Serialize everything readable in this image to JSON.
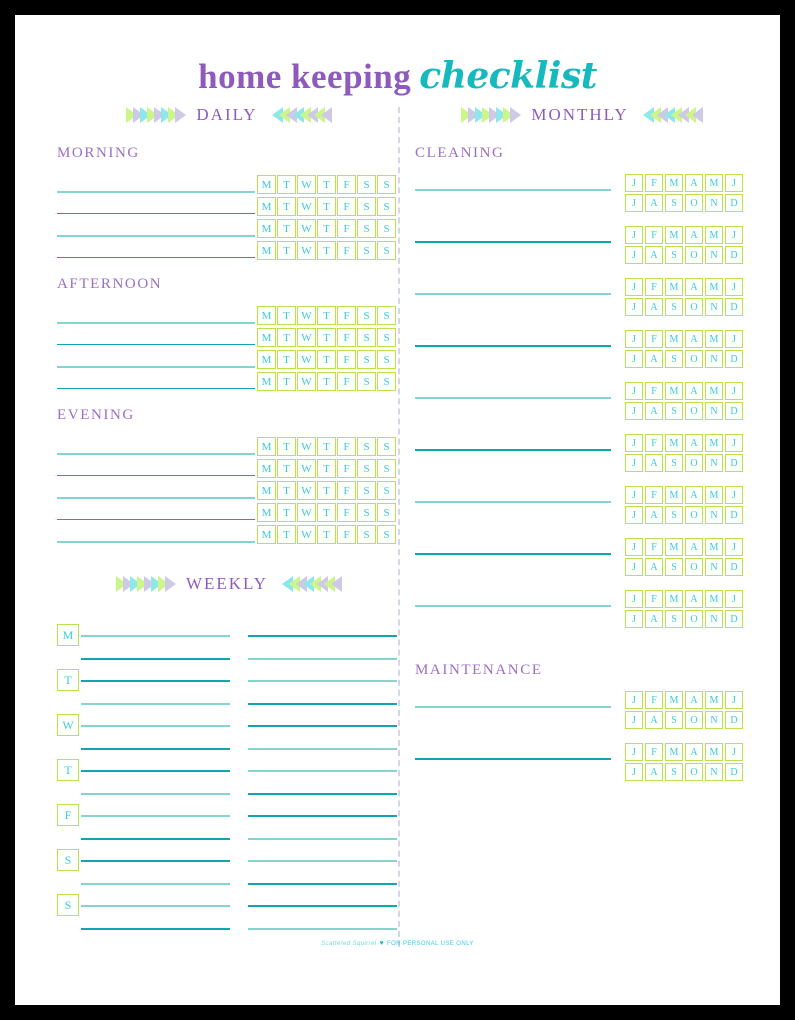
{
  "title": {
    "part1": "home keeping",
    "part2": "checklist",
    "color1": "#8e5bbd",
    "color2": "#16b9bd"
  },
  "palette": {
    "chevron_green": "#ccf58a",
    "chevron_lavender": "#cfc9e8",
    "chevron_cyan": "#8ee8ea",
    "purple_text": "#8e5bbd",
    "box_border": "#b9e34e",
    "box_letter": "#3fc9e0",
    "line_light": "#86d4d2",
    "line_dark": "#12a4b0",
    "divider": "#d6d3ea"
  },
  "chevron_colors": [
    "#ccf58a",
    "#cfc9e8",
    "#8ee8ea",
    "#ccf58a",
    "#cfc9e8",
    "#8ee8ea",
    "#ccf58a",
    "#cfc9e8"
  ],
  "banners": {
    "daily": "DAILY",
    "weekly": "WEEKLY",
    "monthly": "MONTHLY"
  },
  "day_letters": [
    "M",
    "T",
    "W",
    "T",
    "F",
    "S",
    "S"
  ],
  "month_letters_row1": [
    "J",
    "F",
    "M",
    "A",
    "M",
    "J"
  ],
  "month_letters_row2": [
    "J",
    "A",
    "S",
    "O",
    "N",
    "D"
  ],
  "daily": {
    "sections": [
      {
        "title": "MORNING",
        "rows": 4
      },
      {
        "title": "AFTERNOON",
        "rows": 4
      },
      {
        "title": "EVENING",
        "rows": 5
      }
    ]
  },
  "weekly": {
    "days": [
      "M",
      "T",
      "W",
      "T",
      "F",
      "S",
      "S"
    ],
    "columns_per_day": 2,
    "lines_per_column": 2
  },
  "monthly": {
    "sections": [
      {
        "title": "CLEANING",
        "rows": 9
      },
      {
        "title": "MAINTENANCE",
        "rows": 2
      }
    ]
  },
  "footer": {
    "brand": "Scattered Squirrel",
    "heart": "♥",
    "rights": "FOR PERSONAL USE ONLY"
  }
}
